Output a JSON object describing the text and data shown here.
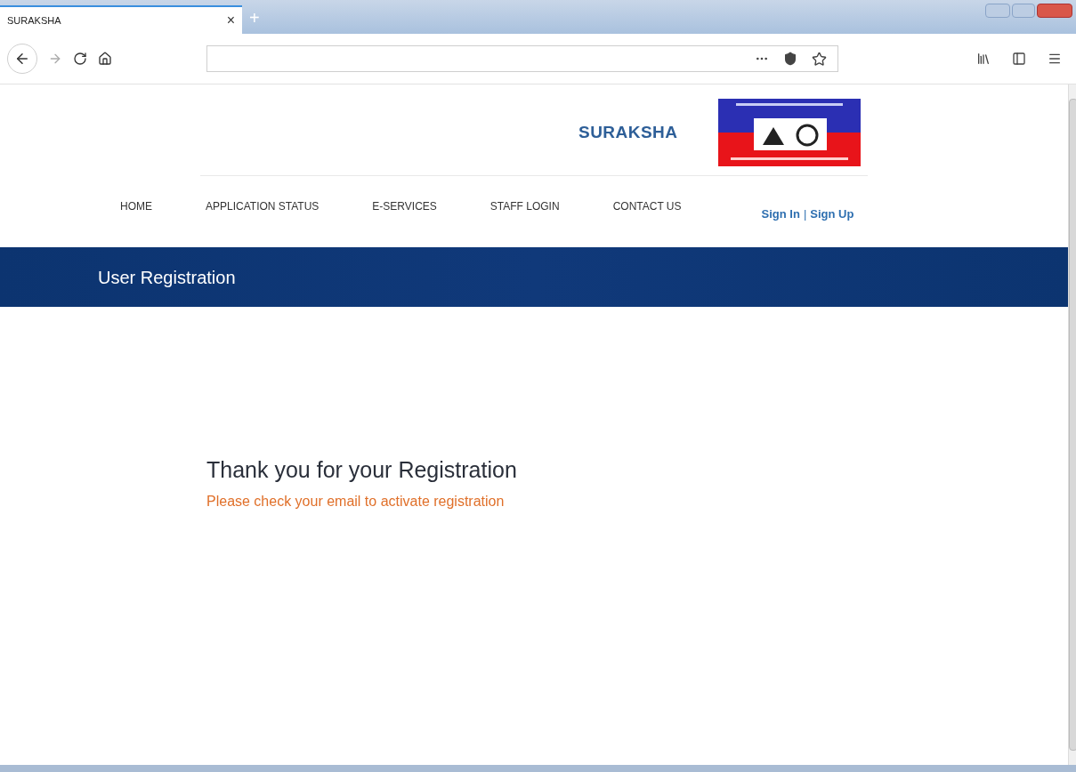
{
  "browser": {
    "tab": {
      "title": "SURAKSHA",
      "close": "×",
      "selected": true
    },
    "new_tab": "+"
  },
  "header": {
    "site_title": "SURAKSHA"
  },
  "nav": {
    "items": [
      {
        "label": "HOME",
        "selected": false
      },
      {
        "label": "APPLICATION STATUS",
        "selected": false
      },
      {
        "label": "E-SERVICES",
        "selected": false
      },
      {
        "label": "STAFF LOGIN",
        "selected": false
      },
      {
        "label": "CONTACT US",
        "selected": false
      }
    ],
    "auth": {
      "sign_in": "Sign In",
      "separator": "|",
      "sign_up": "Sign Up"
    }
  },
  "banner": {
    "title": "User Registration"
  },
  "message": {
    "heading": "Thank you for your Registration",
    "note": "Please check your email to activate registration"
  }
}
